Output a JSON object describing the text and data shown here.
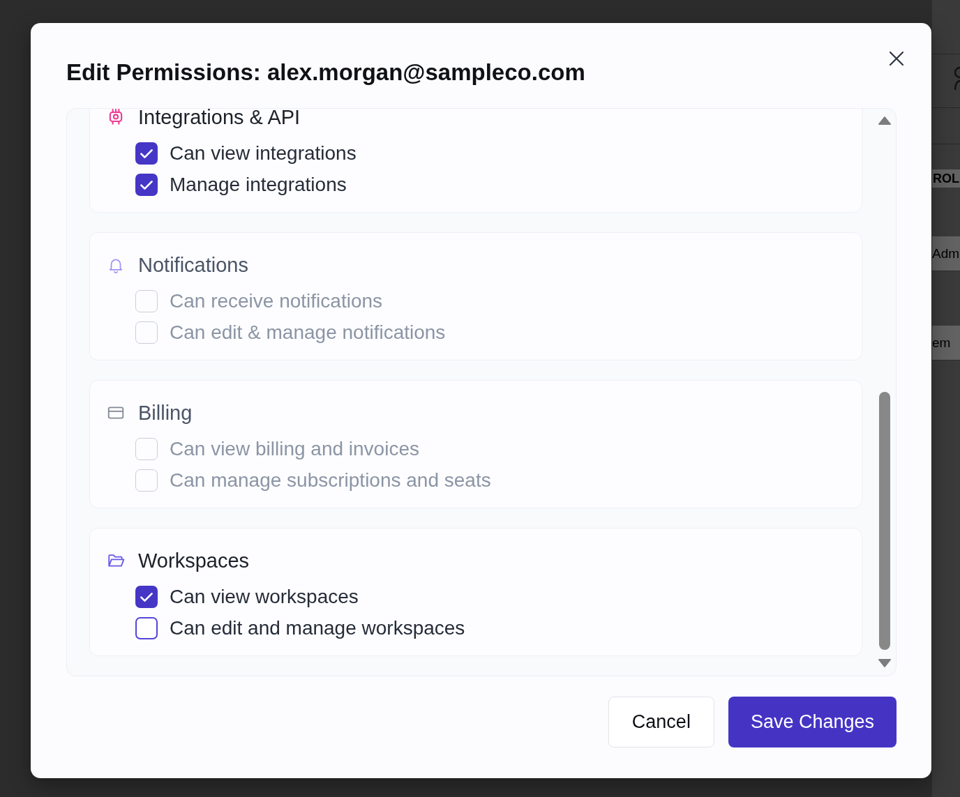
{
  "background_page": {
    "column_header": "ROL",
    "cells": [
      "Adm",
      "em"
    ]
  },
  "dialog": {
    "title": "Edit Permissions: alex.morgan@sampleco.com"
  },
  "sections": [
    {
      "kind": "integrations",
      "title": "Integrations & API",
      "disabled": false,
      "permissions": [
        {
          "label": "Can view integrations",
          "checked": true
        },
        {
          "label": "Manage integrations",
          "checked": true
        }
      ]
    },
    {
      "kind": "notifications",
      "title": "Notifications",
      "disabled": true,
      "permissions": [
        {
          "label": "Can receive notifications",
          "checked": false
        },
        {
          "label": "Can edit & manage notifications",
          "checked": false
        }
      ]
    },
    {
      "kind": "billing",
      "title": "Billing",
      "disabled": true,
      "permissions": [
        {
          "label": "Can view billing and invoices",
          "checked": false
        },
        {
          "label": "Can manage subscriptions and seats",
          "checked": false
        }
      ]
    },
    {
      "kind": "workspaces",
      "title": "Workspaces",
      "disabled": false,
      "permissions": [
        {
          "label": "Can view workspaces",
          "checked": true
        },
        {
          "label": "Can edit and manage workspaces",
          "checked": false
        }
      ]
    }
  ],
  "buttons": [
    {
      "kind": "secondary",
      "label": "Cancel"
    },
    {
      "kind": "primary",
      "label": "Save Changes"
    }
  ]
}
